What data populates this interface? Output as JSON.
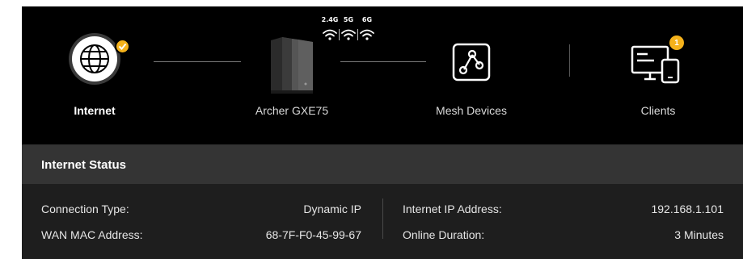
{
  "topology": {
    "internet": {
      "label": "Internet",
      "icon": "globe-icon",
      "status": "connected"
    },
    "router": {
      "label": "Archer GXE75",
      "bands": [
        "2.4G",
        "5G",
        "6G"
      ]
    },
    "mesh": {
      "label": "Mesh Devices",
      "icon": "mesh-network-icon"
    },
    "clients": {
      "label": "Clients",
      "count": "1"
    }
  },
  "internet_status": {
    "title": "Internet Status",
    "left": [
      {
        "label": "Connection Type:",
        "value": "Dynamic IP"
      },
      {
        "label": "WAN MAC Address:",
        "value": "68-7F-F0-45-99-67"
      }
    ],
    "right": [
      {
        "label": "Internet IP Address:",
        "value": "192.168.1.101"
      },
      {
        "label": "Online Duration:",
        "value": "3 Minutes"
      }
    ]
  },
  "colors": {
    "accent": "#f5b21b",
    "background": "#000000",
    "panel": "#1e1e1e",
    "panel_header": "#343434"
  }
}
